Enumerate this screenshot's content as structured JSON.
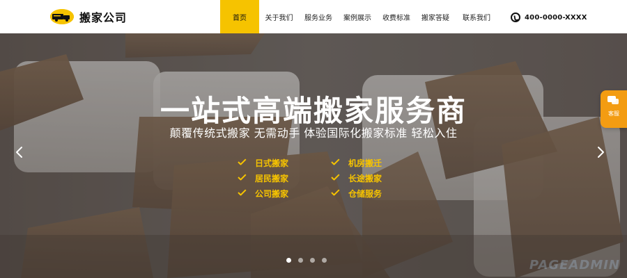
{
  "brand": {
    "name": "搬家公司"
  },
  "nav": {
    "items": [
      {
        "label": "首页",
        "active": true
      },
      {
        "label": "关于我们",
        "active": false
      },
      {
        "label": "服务业务",
        "active": false
      },
      {
        "label": "案例展示",
        "active": false
      },
      {
        "label": "收费标准",
        "active": false
      },
      {
        "label": "搬家答疑",
        "active": false
      },
      {
        "label": "联系我们",
        "active": false
      }
    ]
  },
  "contact": {
    "phone": "400-0000-XXXX",
    "icon": "phone-icon"
  },
  "hero": {
    "headline": "一站式高端搬家服务商",
    "subline": "颠覆传统式搬家 无需动手 体验国际化搬家标准 轻松入住",
    "features_left": [
      "日式搬家",
      "居民搬家",
      "公司搬家"
    ],
    "features_right": [
      "机房搬迁",
      "长途搬家",
      "仓储服务"
    ],
    "carousel": {
      "slides": 4,
      "active_index": 0
    }
  },
  "service_tab": {
    "label": "客服",
    "icon": "chat-icon"
  },
  "watermark": {
    "text": "PAGEADMIN"
  },
  "colors": {
    "accent": "#f6c300",
    "service_orange": "#f39c12"
  }
}
